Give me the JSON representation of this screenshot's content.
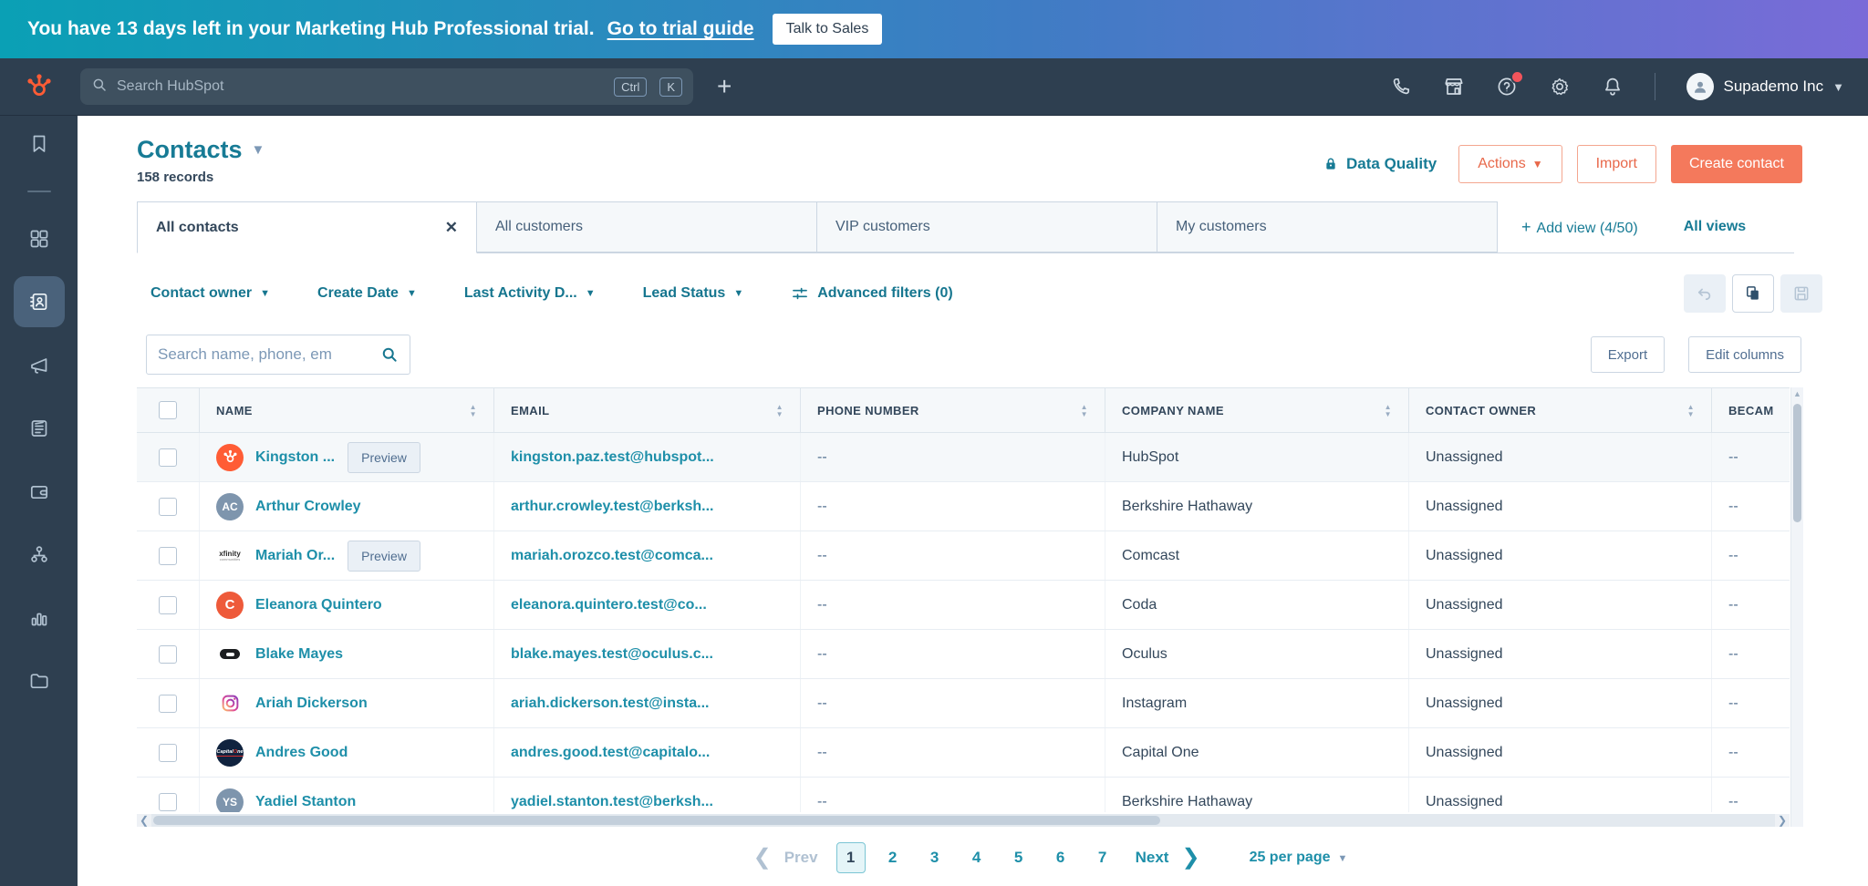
{
  "banner": {
    "text": "You have 13 days left in your Marketing Hub Professional trial.",
    "link": "Go to trial guide",
    "button": "Talk to Sales"
  },
  "topnav": {
    "search_placeholder": "Search HubSpot",
    "shortcut_keys": [
      "Ctrl",
      "K"
    ],
    "icons": [
      "phone-icon",
      "marketplace-icon",
      "help-icon",
      "settings-icon",
      "notifications-icon"
    ],
    "help_has_badge": true,
    "account_name": "Supademo Inc"
  },
  "sidebar": {
    "items": [
      "bookmark",
      "dashboards-grid",
      "contacts-book",
      "megaphone",
      "content-doc",
      "wallet",
      "workflow",
      "bar-chart",
      "folder"
    ],
    "active_item": "contacts-book"
  },
  "header": {
    "title": "Contacts",
    "records": "158 records",
    "data_quality": "Data Quality",
    "actions": "Actions",
    "import": "Import",
    "create_contact": "Create contact"
  },
  "views": {
    "tabs": [
      {
        "label": "All contacts",
        "active": true,
        "closable": true
      },
      {
        "label": "All customers",
        "active": false,
        "closable": false
      },
      {
        "label": "VIP customers",
        "active": false,
        "closable": false
      },
      {
        "label": "My customers",
        "active": false,
        "closable": false
      }
    ],
    "add_view": "Add view (4/50)",
    "all_views": "All views"
  },
  "filters": {
    "dropdowns": [
      "Contact owner",
      "Create Date",
      "Last Activity D...",
      "Lead Status"
    ],
    "advanced": "Advanced filters (0)",
    "view_buttons": [
      "undo",
      "copy",
      "save"
    ]
  },
  "toolbar": {
    "search_placeholder": "Search name, phone, em",
    "export": "Export",
    "edit_columns": "Edit columns"
  },
  "table": {
    "columns": [
      "NAME",
      "EMAIL",
      "PHONE NUMBER",
      "COMPANY NAME",
      "CONTACT OWNER",
      "BECAM"
    ],
    "rows": [
      {
        "name": "Kingston ...",
        "preview": "Preview",
        "email": "kingston.paz.test@hubspot...",
        "phone": "--",
        "company": "HubSpot",
        "owner": "Unassigned",
        "became": "--",
        "avatar": {
          "type": "logo",
          "logo": "hubspot"
        },
        "highlighted": true
      },
      {
        "name": "Arthur Crowley",
        "preview": null,
        "email": "arthur.crowley.test@berksh...",
        "phone": "--",
        "company": "Berkshire Hathaway",
        "owner": "Unassigned",
        "became": "--",
        "avatar": {
          "type": "initials",
          "text": "AC"
        },
        "highlighted": false
      },
      {
        "name": "Mariah Or...",
        "preview": "Preview",
        "email": "mariah.orozco.test@comca...",
        "phone": "--",
        "company": "Comcast",
        "owner": "Unassigned",
        "became": "--",
        "avatar": {
          "type": "logo",
          "logo": "xfinity"
        },
        "highlighted": false
      },
      {
        "name": "Eleanora Quintero",
        "preview": null,
        "email": "eleanora.quintero.test@co...",
        "phone": "--",
        "company": "Coda",
        "owner": "Unassigned",
        "became": "--",
        "avatar": {
          "type": "logo",
          "logo": "coda"
        },
        "highlighted": false
      },
      {
        "name": "Blake Mayes",
        "preview": null,
        "email": "blake.mayes.test@oculus.c...",
        "phone": "--",
        "company": "Oculus",
        "owner": "Unassigned",
        "became": "--",
        "avatar": {
          "type": "logo",
          "logo": "oculus"
        },
        "highlighted": false
      },
      {
        "name": "Ariah Dickerson",
        "preview": null,
        "email": "ariah.dickerson.test@insta...",
        "phone": "--",
        "company": "Instagram",
        "owner": "Unassigned",
        "became": "--",
        "avatar": {
          "type": "logo",
          "logo": "instagram"
        },
        "highlighted": false
      },
      {
        "name": "Andres Good",
        "preview": null,
        "email": "andres.good.test@capitalo...",
        "phone": "--",
        "company": "Capital One",
        "owner": "Unassigned",
        "became": "--",
        "avatar": {
          "type": "logo",
          "logo": "capitalone"
        },
        "highlighted": false
      },
      {
        "name": "Yadiel Stanton",
        "preview": null,
        "email": "yadiel.stanton.test@berksh...",
        "phone": "--",
        "company": "Berkshire Hathaway",
        "owner": "Unassigned",
        "became": "--",
        "avatar": {
          "type": "initials",
          "text": "YS"
        },
        "highlighted": false
      }
    ]
  },
  "pagination": {
    "prev": "Prev",
    "pages": [
      "1",
      "2",
      "3",
      "4",
      "5",
      "6",
      "7"
    ],
    "current": "1",
    "next": "Next",
    "per_page": "25 per page"
  },
  "colors": {
    "banner_gradient_start": "#0aa0b5",
    "banner_gradient_end": "#7a6bd8",
    "nav_navy": "#2e3f50",
    "teal_heading": "#177b95",
    "teal_link": "#1e8fa9",
    "orange_primary": "#f4795c",
    "text_dark": "#33475b",
    "text_muted": "#516f90",
    "border": "#cbd6e2",
    "row_highlight": "#f5f8fa",
    "hubspot_logo_orange": "#ff5c35",
    "badge_red": "#f2545b"
  }
}
